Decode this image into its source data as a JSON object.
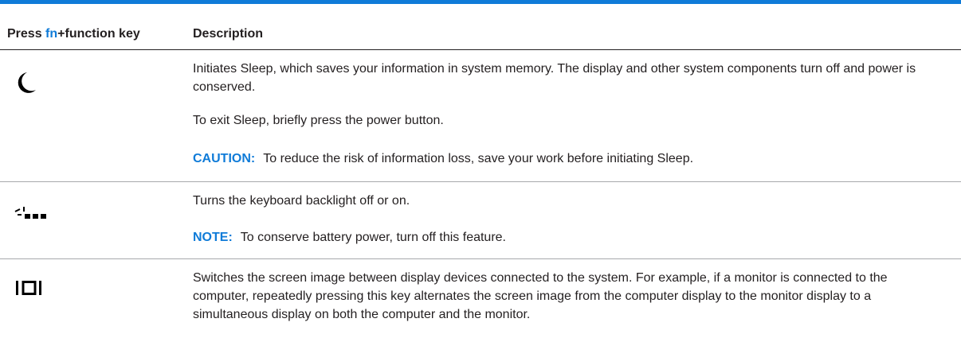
{
  "header": {
    "press_prefix": "Press ",
    "fn": "fn",
    "press_suffix": "+function key",
    "description": "Description"
  },
  "rows": [
    {
      "icon": "sleep-moon-icon",
      "paragraphs": [
        "Initiates Sleep, which saves your information in system memory. The display and other system components turn off and power is conserved.",
        "To exit Sleep, briefly press the power button."
      ],
      "note_label": "CAUTION:",
      "note_text": "To reduce the risk of information loss, save your work before initiating Sleep."
    },
    {
      "icon": "keyboard-backlight-icon",
      "paragraphs": [
        "Turns the keyboard backlight off or on."
      ],
      "note_label": "NOTE:",
      "note_text": "To conserve battery power, turn off this feature."
    },
    {
      "icon": "switch-display-icon",
      "paragraphs": [
        "Switches the screen image between display devices connected to the system. For example, if a monitor is connected to the computer, repeatedly pressing this key alternates the screen image from the computer display to the monitor display to a simultaneous display on both the computer and the monitor."
      ]
    }
  ],
  "colors": {
    "accent": "#0f7bd8",
    "text": "#231f20",
    "divider": "#a7a9ac"
  }
}
